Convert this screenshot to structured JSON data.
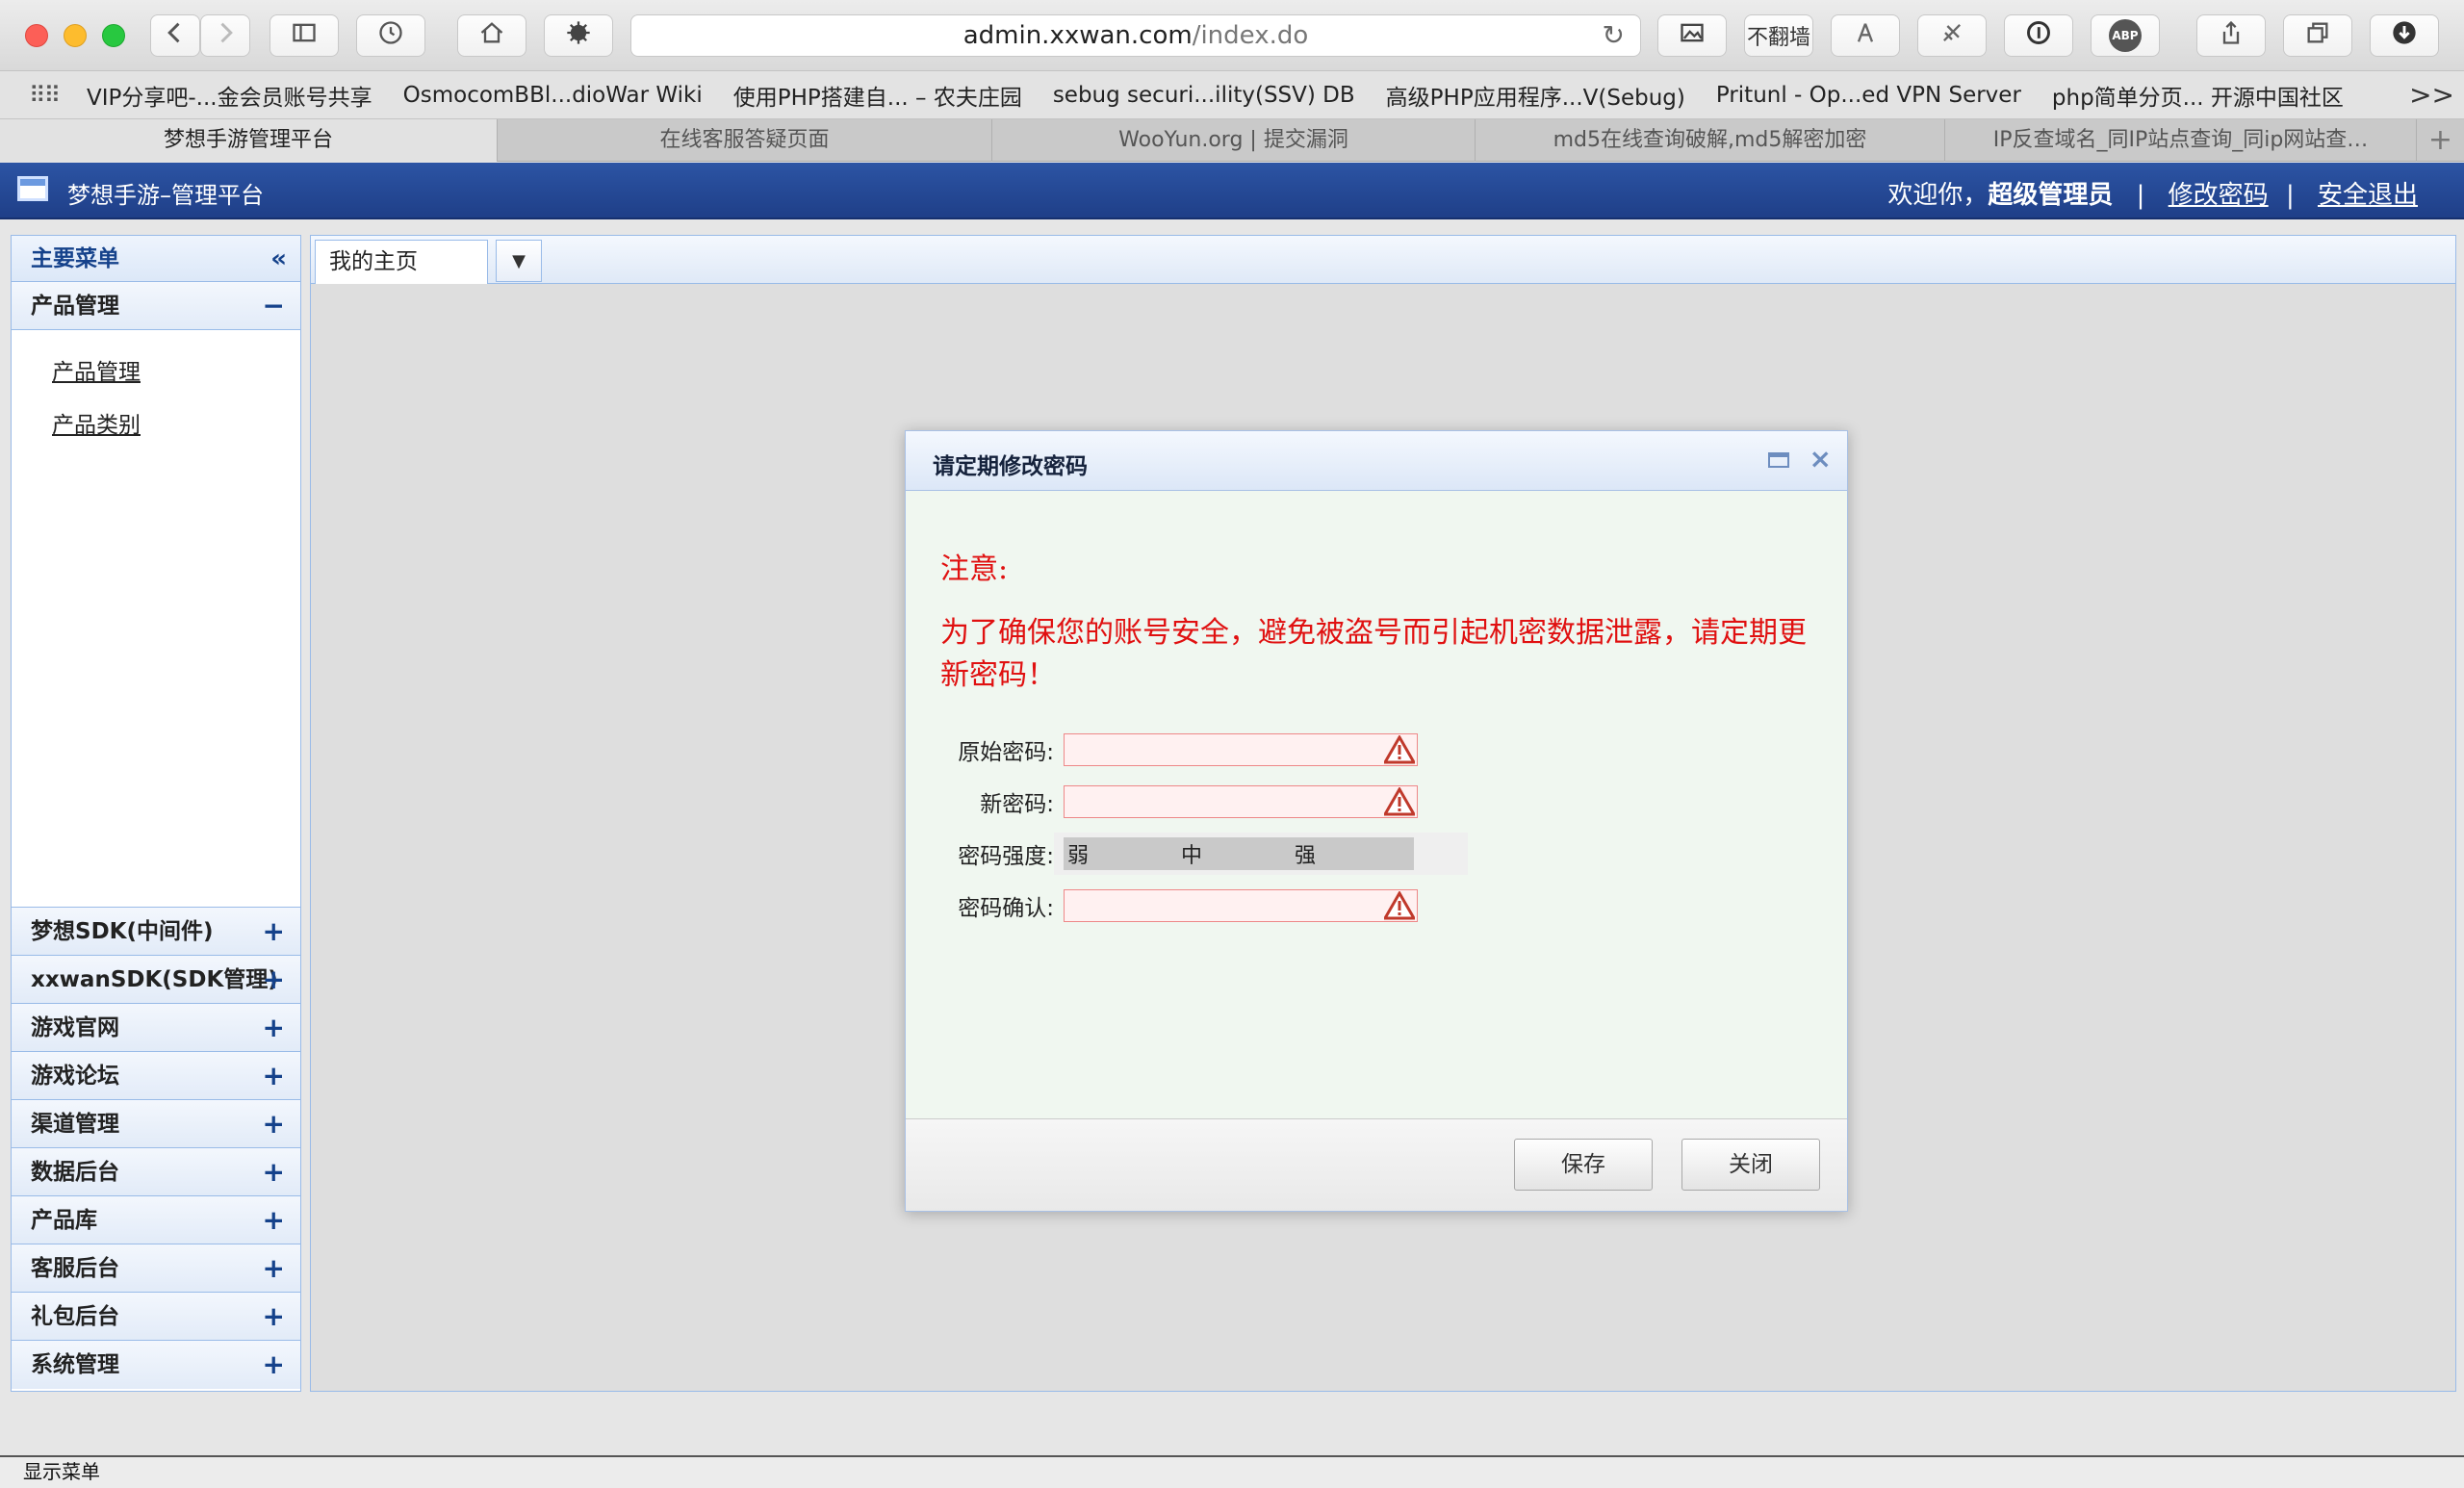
{
  "browser": {
    "url_host": "admin.xxwan.com",
    "url_path": "/index.do",
    "toolbar_icon_labels": [
      "back-icon",
      "forward-icon",
      "sidebar-icon",
      "history-icon",
      "home-icon",
      "extension-icon",
      "image-icon",
      "bypass-icon",
      "antenna-icon",
      "satellite-icon",
      "1password-icon",
      "abp-icon",
      "share-icon",
      "tabs-icon",
      "download-icon"
    ],
    "abp_label": "ABP",
    "bypass_label": "不翻墙",
    "bookmarks": [
      "VIP分享吧-...金会员账号共享",
      "OsmocomBBl...dioWar Wiki",
      "使用PHP搭建自... – 农夫庄园",
      "sebug securi...ility(SSV) DB",
      "高级PHP应用程序...V(Sebug)",
      "Pritunl - Op...ed VPN Server",
      "php简单分页... 开源中国社区"
    ],
    "bookmarks_more": ">>",
    "tabs": [
      "梦想手游管理平台",
      "在线客服答疑页面",
      "WooYun.org | 提交漏洞",
      "md5在线查询破解,md5解密加密",
      "IP反查域名_同IP站点查询_同ip网站查…"
    ],
    "tab_add": "+"
  },
  "header": {
    "title": "梦想手游–管理平台",
    "welcome": "欢迎你，",
    "user": "超级管理员",
    "sep": "|",
    "change_password": "修改密码",
    "logout": "安全退出"
  },
  "sidebar": {
    "title": "主要菜单",
    "collapse": "«",
    "active_section": {
      "label": "产品管理",
      "toggle": "−"
    },
    "links": [
      "产品管理",
      "产品类别"
    ],
    "sections": [
      {
        "label": "梦想SDK(中间件)",
        "toggle": "+"
      },
      {
        "label": "xxwanSDK(SDK管理)",
        "toggle": "+"
      },
      {
        "label": "游戏官网",
        "toggle": "+"
      },
      {
        "label": "游戏论坛",
        "toggle": "+"
      },
      {
        "label": "渠道管理",
        "toggle": "+"
      },
      {
        "label": "数据后台",
        "toggle": "+"
      },
      {
        "label": "产品库",
        "toggle": "+"
      },
      {
        "label": "客服后台",
        "toggle": "+"
      },
      {
        "label": "礼包后台",
        "toggle": "+"
      },
      {
        "label": "系统管理",
        "toggle": "+"
      }
    ]
  },
  "main": {
    "tab_label": "我的主页",
    "tab_menu": "▼"
  },
  "dialog": {
    "title": "请定期修改密码",
    "close": "×",
    "notice_title": "注意:",
    "notice_text": "为了确保您的账号安全，避免被盗号而引起机密数据泄露，请定期更新密码！",
    "labels": {
      "old_password": "原始密码:",
      "new_password": "新密码:",
      "strength": "密码强度:",
      "confirm": "密码确认:"
    },
    "strength_levels": [
      "弱",
      "中",
      "强"
    ],
    "save": "保存",
    "close_button": "关闭"
  },
  "statusbar": {
    "text": "显示菜单"
  },
  "colors": {
    "header_blue": "#1f3f88",
    "notice_red": "#e01010",
    "border_blue": "#99bbe8"
  }
}
